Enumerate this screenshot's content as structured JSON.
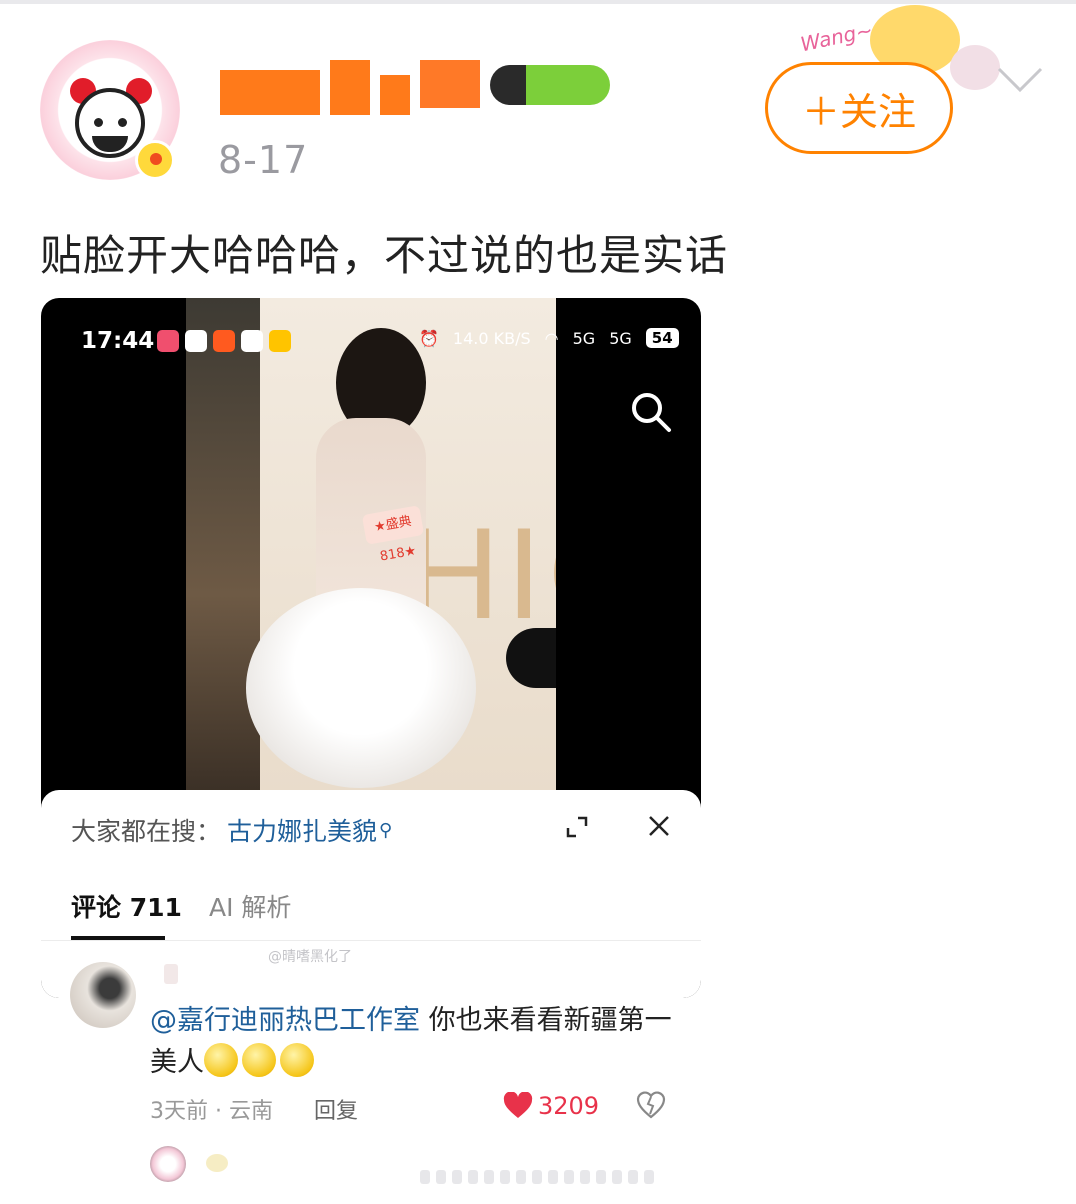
{
  "post": {
    "date": "8-17",
    "text": "贴脸开大哈哈哈，不过说的也是实话",
    "follow_label": "＋关注",
    "sticker_text": "Wang~"
  },
  "embedded": {
    "status": {
      "time": "17:44",
      "speed": "14.0 KB/S",
      "signal1": "5G",
      "signal2": "5G",
      "battery": "54"
    },
    "photo_sticker": "★盛典 818★",
    "photo_wall_text": "HIO",
    "search_bar": {
      "prefix": "大家都在搜：",
      "term": "古力娜扎美貌",
      "term_icon": "search-small-icon"
    },
    "tabs": [
      {
        "label": "评论 711",
        "active": true
      },
      {
        "label": "AI 解析",
        "active": false
      }
    ],
    "watermark": "@晴嗜黑化了",
    "comment": {
      "mention": "@嘉行迪丽热巴工作室",
      "text": " 你也来看看新疆第一美人",
      "meta": "3天前 · 云南",
      "reply_label": "回复",
      "likes": "3209"
    }
  },
  "colors": {
    "accent_orange": "#ff8200",
    "link_blue": "#1f5f9a",
    "like_red": "#e8324a"
  },
  "icons": [
    "chevron-down-icon",
    "search-icon",
    "expand-icon",
    "close-icon",
    "heart-icon",
    "dislike-icon"
  ]
}
